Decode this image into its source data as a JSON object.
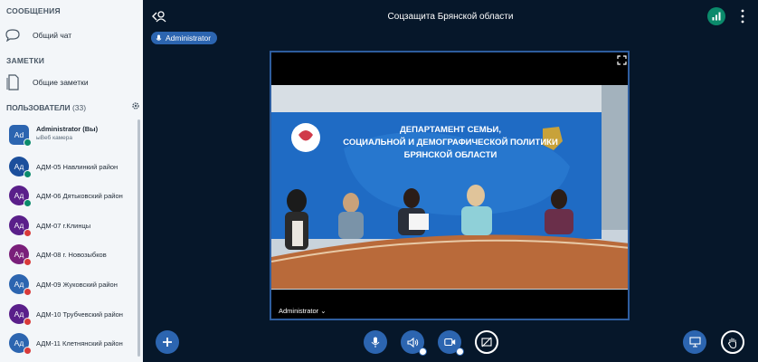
{
  "sidebar": {
    "messages_title": "СООБЩЕНИЯ",
    "public_chat": "Общий чат",
    "notes_title": "ЗАМЕТКИ",
    "shared_notes": "Общие заметки",
    "users_title": "ПОЛЬЗОВАТЕЛИ",
    "users_count": "(33)",
    "me": {
      "initials": "Ad",
      "name": "Administrator",
      "you": "(Вы)",
      "sub": "ыВеб камера"
    },
    "users": [
      {
        "initials": "Ад",
        "name": "АДМ-05 Навлинкий район",
        "color": "#1b4f9c",
        "status": "#0b8a6b"
      },
      {
        "initials": "Ад",
        "name": "АДМ-06 Дятьковский район",
        "color": "#5a1f8a",
        "status": "#0b8a6b"
      },
      {
        "initials": "Ад",
        "name": "АДМ-07 г.Клинцы",
        "color": "#5a1f8a",
        "status": "#d83a3a"
      },
      {
        "initials": "Ад",
        "name": "АДМ-08 г. Новозыбков",
        "color": "#7a1f7a",
        "status": "#d83a3a"
      },
      {
        "initials": "Ад",
        "name": "АДМ-09 Жуковский район",
        "color": "#2c65b0",
        "status": "#d83a3a"
      },
      {
        "initials": "Ад",
        "name": "АДМ-10 Трубчевский район",
        "color": "#5a1f8a",
        "status": "#d83a3a"
      },
      {
        "initials": "Ад",
        "name": "АДМ-11 Клетнянский район",
        "color": "#2c65b0",
        "status": "#d83a3a"
      }
    ]
  },
  "main": {
    "title": "Соцзащита Брянской области",
    "presenter": "Administrator",
    "video_label": "Administrator",
    "banner": [
      "ДЕПАРТАМЕНТ СЕМЬИ,",
      "СОЦИАЛЬНОЙ И ДЕМОГРАФИЧЕСКОЙ ПОЛИТИКИ",
      "БРЯНСКОЙ ОБЛАСТИ"
    ]
  },
  "colors": {
    "accent": "#2c65b0",
    "background": "#06172a",
    "connection": "#0b8a6b"
  }
}
